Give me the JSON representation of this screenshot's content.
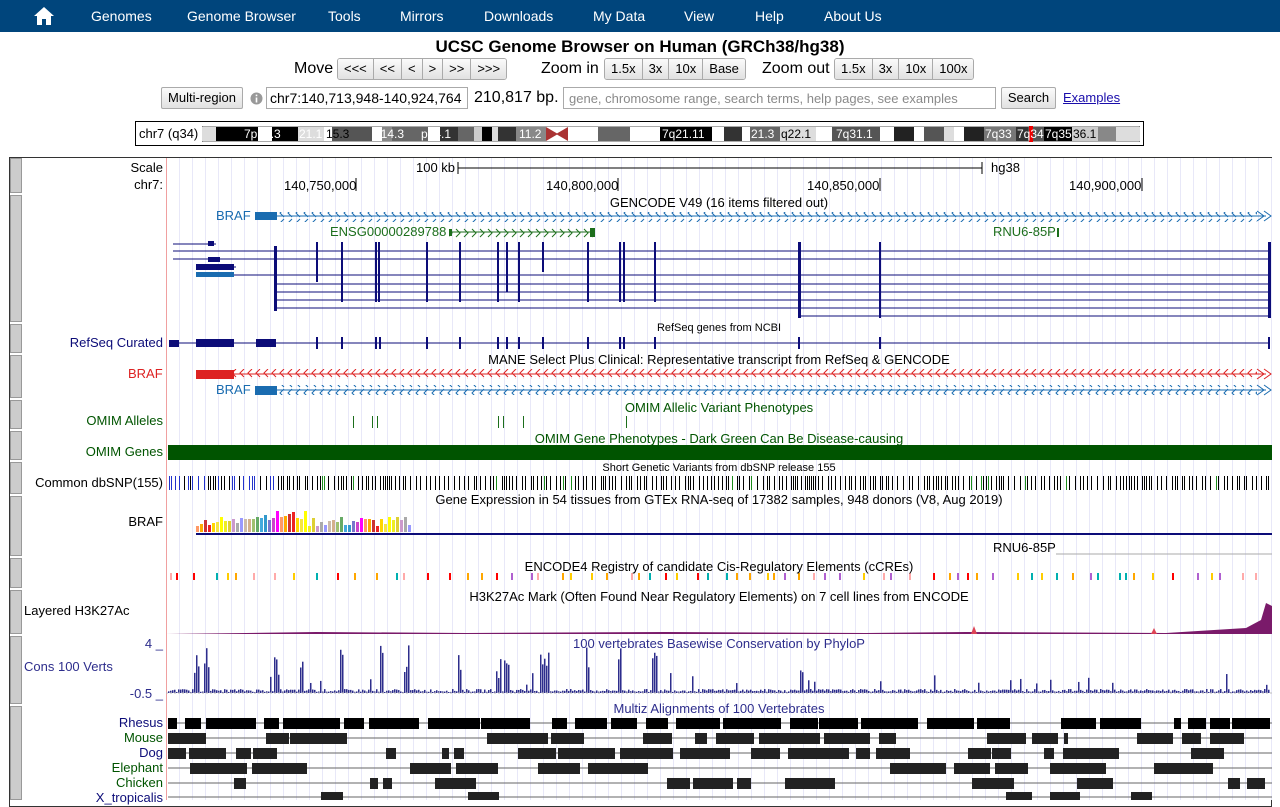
{
  "nav": {
    "items": [
      "Genomes",
      "Genome Browser",
      "Tools",
      "Mirrors",
      "Downloads",
      "My Data",
      "View",
      "Help",
      "About Us"
    ]
  },
  "page_title": "UCSC Genome Browser on Human (GRCh38/hg38)",
  "controls": {
    "move_label": "Move",
    "move_buttons": [
      "<<<",
      "<<",
      "<",
      ">",
      ">>",
      ">>>"
    ],
    "zoom_in_label": "Zoom in",
    "zoom_in_buttons": [
      "1.5x",
      "3x",
      "10x",
      "Base"
    ],
    "zoom_out_label": "Zoom out",
    "zoom_out_buttons": [
      "1.5x",
      "3x",
      "10x",
      "100x"
    ],
    "multi_region": "Multi-region",
    "position": "chr7:140,713,948-140,924,764",
    "size": "210,817 bp.",
    "search_placeholder": "gene, chromosome range, search terms, help pages, see examples",
    "search_button": "Search",
    "examples_link": "Examples"
  },
  "ideogram": {
    "label": "chr7 (q34)",
    "bands": [
      "7p21.3",
      "21.1",
      "15.3",
      "p14.3",
      "p14.1",
      "11.2",
      "7q21.11",
      "21.3",
      "q22.1",
      "7q31.1",
      "7q33",
      "7q34",
      "7q35",
      "36.1"
    ]
  },
  "ruler": {
    "scale_label": "Scale",
    "chrom_label": "chr7:",
    "scale_text": "100 kb",
    "assembly": "hg38",
    "positions": [
      "140,750,000",
      "140,800,000",
      "140,850,000",
      "140,900,000"
    ]
  },
  "tracks": {
    "gencode_title": "GENCODE V49 (16 items filtered out)",
    "gencode_braf": "BRAF",
    "gencode_ensg": "ENSG00000289788",
    "gencode_rnu6": "RNU6-85P",
    "refseq_title": "RefSeq genes from NCBI",
    "refseq_label": "RefSeq Curated",
    "mane_title": "MANE Select Plus Clinical: Representative transcript from RefSeq & GENCODE",
    "mane_braf_1": "BRAF",
    "mane_braf_2": "BRAF",
    "omim_alleles_title": "OMIM Allelic Variant Phenotypes",
    "omim_alleles_label": "OMIM Alleles",
    "omim_genes_title": "OMIM Gene Phenotypes - Dark Green Can Be Disease-causing",
    "omim_genes_label": "OMIM Genes",
    "dbsnp_title": "Short Genetic Variants from dbSNP release 155",
    "dbsnp_label": "Common dbSNP(155)",
    "gtex_title": "Gene Expression in 54 tissues from GTEx RNA-seq of 17382 samples, 948 donors (V8, Aug 2019)",
    "gtex_label": "BRAF",
    "gtex_rnu6": "RNU6-85P",
    "encode_title": "ENCODE4 Registry of candidate Cis-Regulatory Elements (cCREs)",
    "h3k27_title": "H3K27Ac Mark (Often Found Near Regulatory Elements) on 7 cell lines from ENCODE",
    "h3k27_label": "Layered H3K27Ac",
    "cons_title": "100 vertebrates Basewise Conservation by PhyloP",
    "cons_label": "Cons 100 Verts",
    "cons_max": "4 _",
    "cons_min": "-0.5 _",
    "multiz_title": "Multiz Alignments of 100 Vertebrates",
    "species": [
      "Rhesus",
      "Mouse",
      "Dog",
      "Elephant",
      "Chicken",
      "X_tropicalis"
    ]
  },
  "colors": {
    "nav_bg": "#00457c",
    "gencode": "#1a6cb0",
    "ensg": "#1c6e1c",
    "refseq": "#0c0c78",
    "mane": "#dd2222",
    "omim": "#005400",
    "conservation": "#2d2d8c"
  }
}
